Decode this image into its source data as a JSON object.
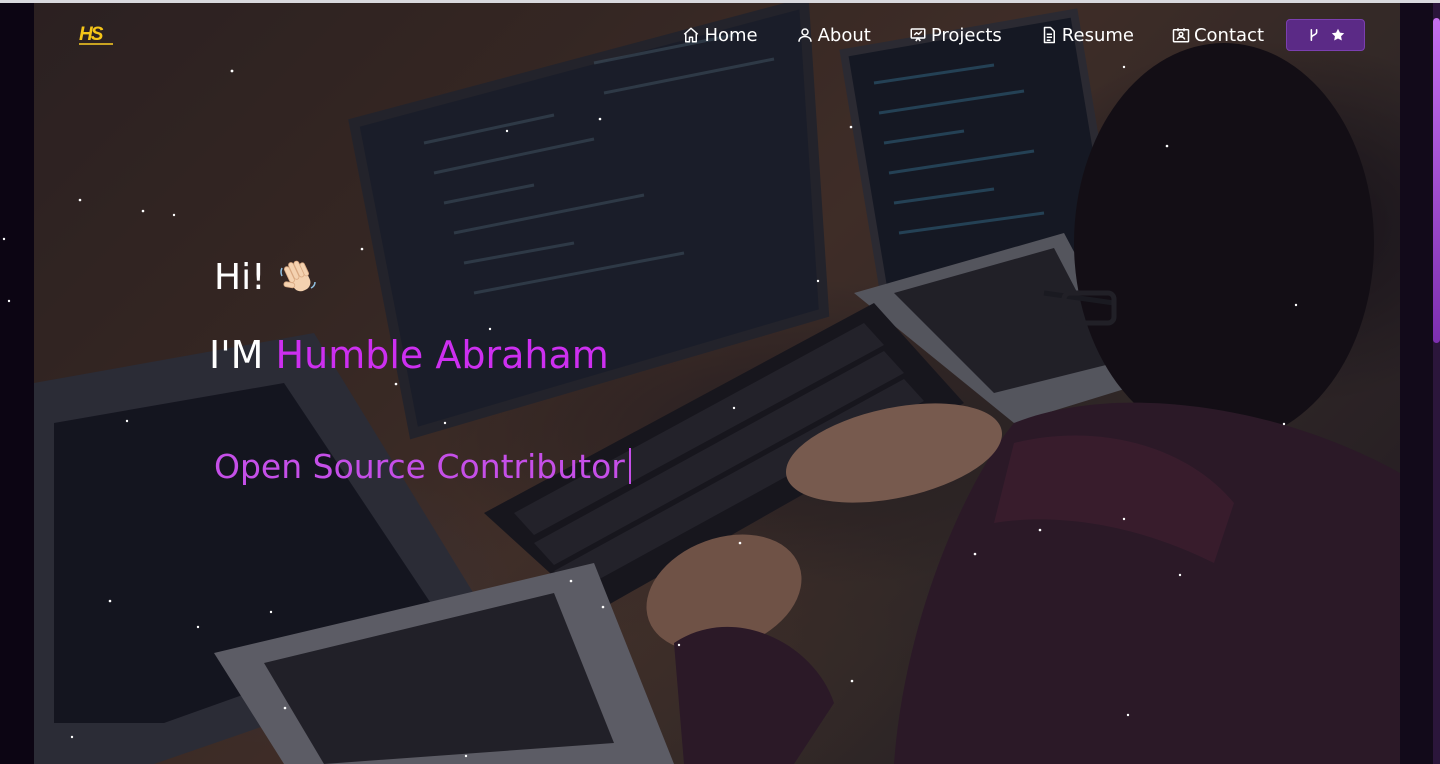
{
  "colors": {
    "accent": "#cd2ff0",
    "typewriter": "#c54fe8",
    "nav_button_bg": "#5b2a86",
    "logo": "#f5c518",
    "text": "#ffffff"
  },
  "navbar": {
    "logo_text": "HS",
    "items": [
      {
        "label": "Home",
        "icon": "home-icon"
      },
      {
        "label": "About",
        "icon": "user-icon"
      },
      {
        "label": "Projects",
        "icon": "projects-icon"
      },
      {
        "label": "Resume",
        "icon": "document-icon"
      },
      {
        "label": "Contact",
        "icon": "contact-icon"
      }
    ],
    "fork_button": {
      "icons": [
        "git-fork-icon",
        "star-icon"
      ]
    }
  },
  "hero": {
    "greeting": "Hi!",
    "greeting_icon": "waving-hand-icon",
    "intro_prefix": "I'M",
    "name": "Humble Abraham",
    "typewriter_text": "Open Source Contributor"
  }
}
